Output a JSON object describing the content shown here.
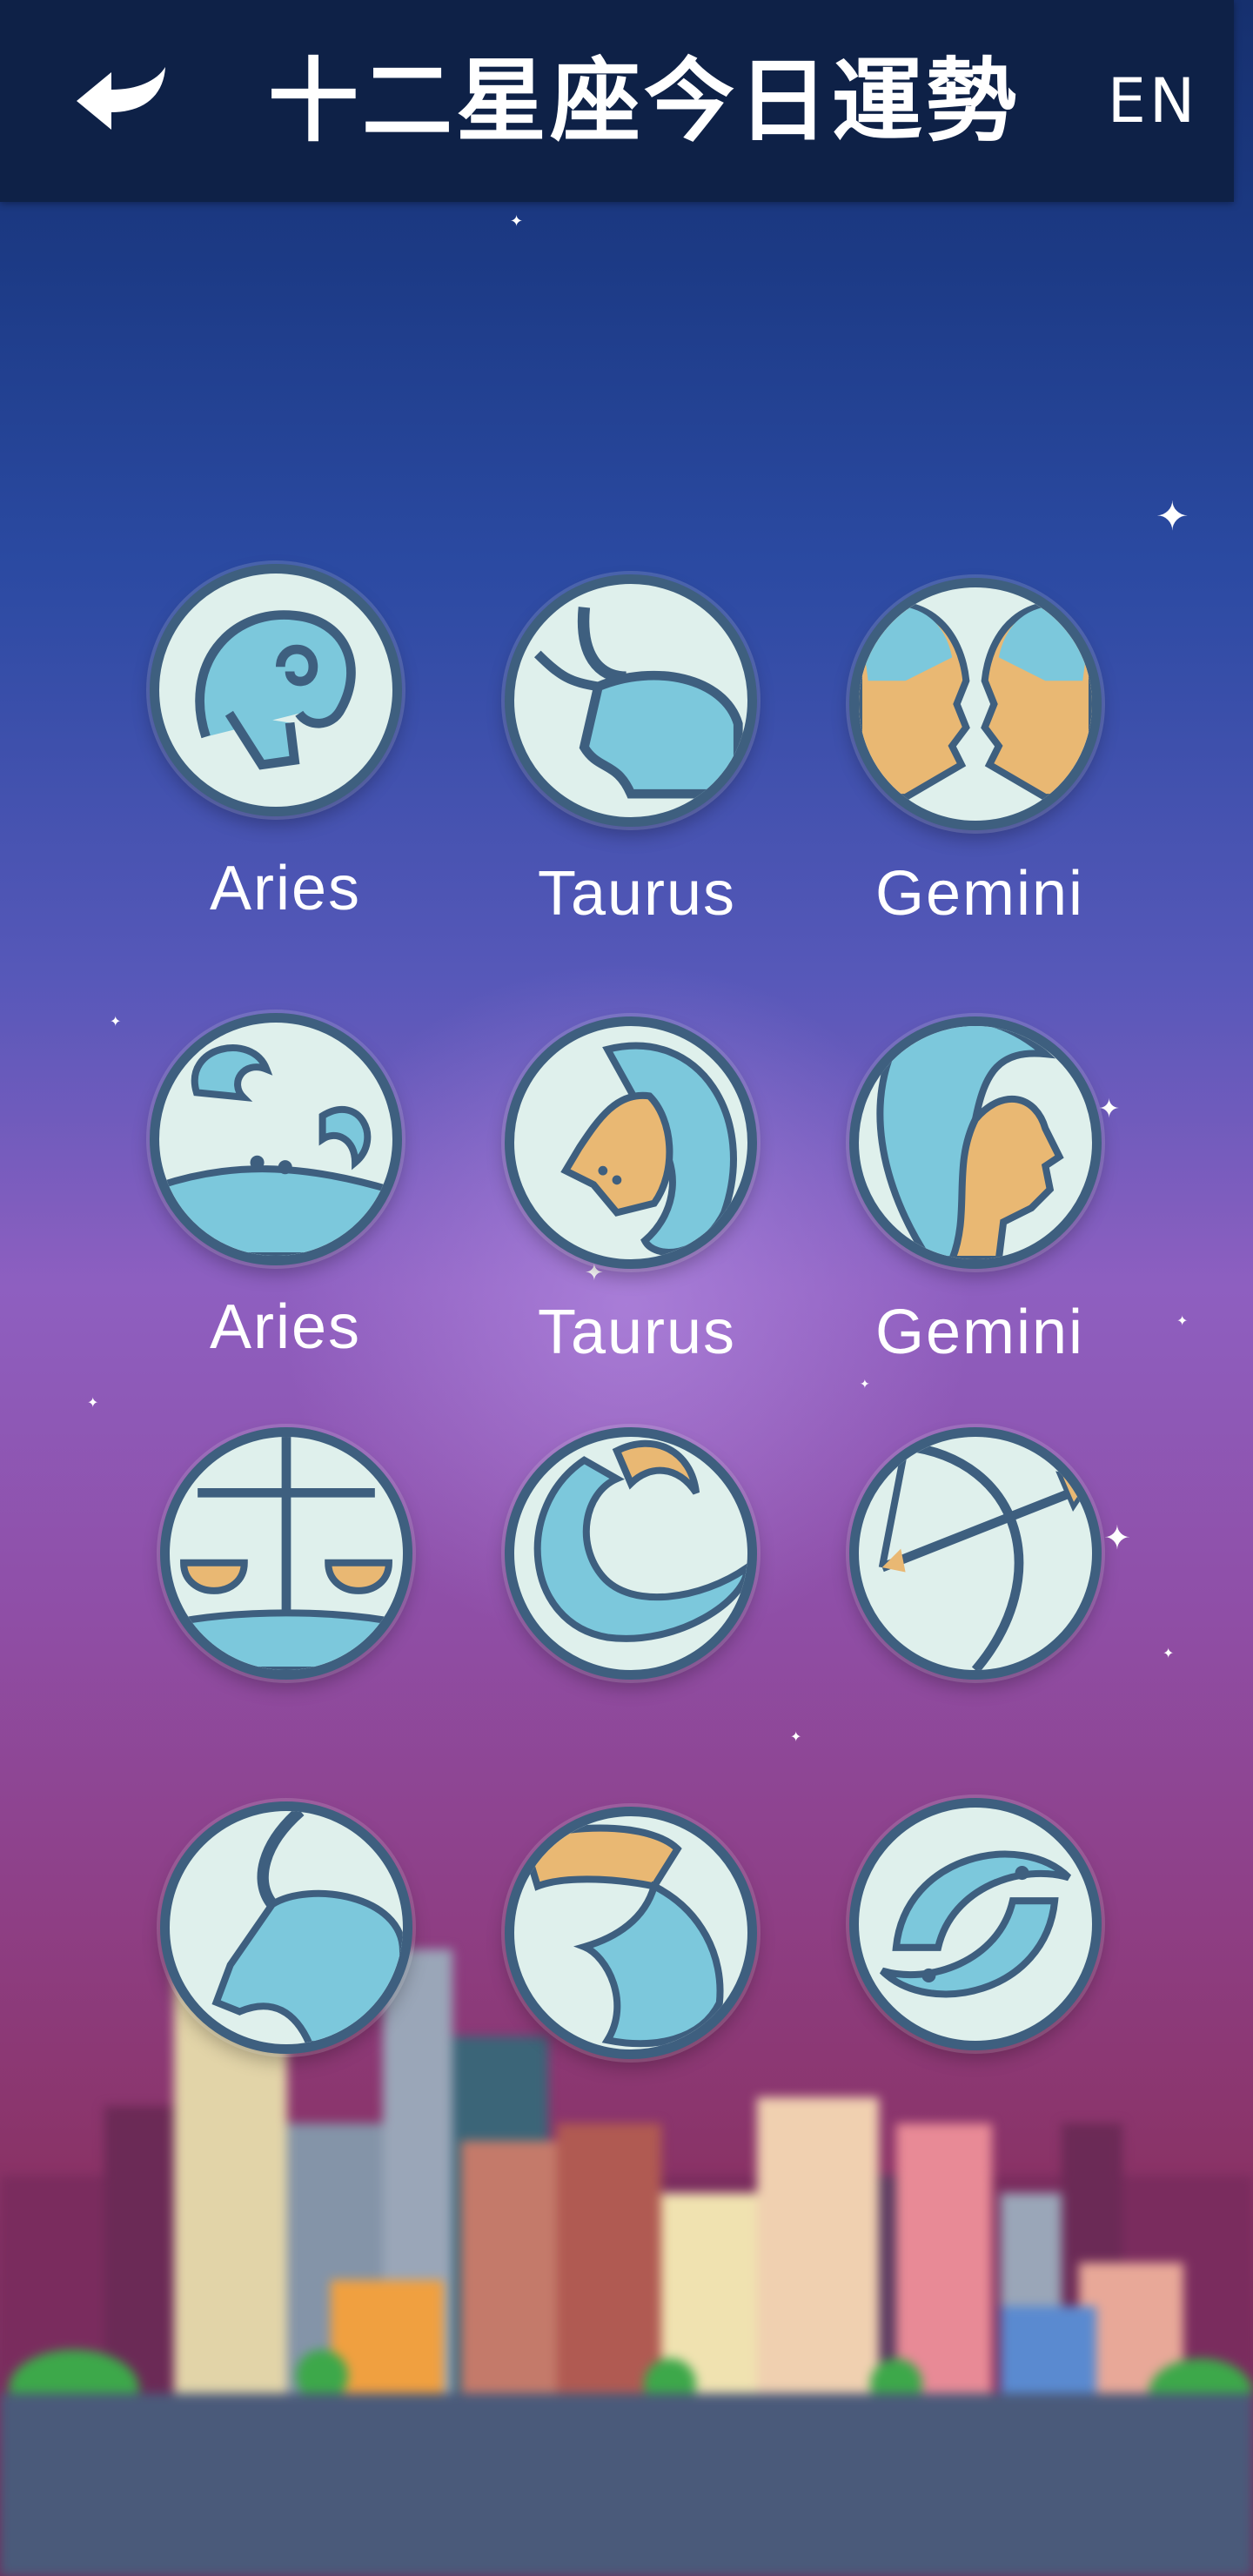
{
  "header": {
    "title": "十二星座今日運勢",
    "language_toggle": "EN",
    "back_icon": "back-arrow-icon"
  },
  "signs": [
    {
      "label": "Aries",
      "icon": "aries-ram-icon"
    },
    {
      "label": "Taurus",
      "icon": "taurus-bull-icon"
    },
    {
      "label": "Gemini",
      "icon": "gemini-twins-icon"
    },
    {
      "label": "Aries",
      "icon": "cancer-crab-icon"
    },
    {
      "label": "Taurus",
      "icon": "leo-lion-icon"
    },
    {
      "label": "Gemini",
      "icon": "virgo-maiden-icon"
    },
    {
      "label": "",
      "icon": "libra-scales-icon"
    },
    {
      "label": "",
      "icon": "scorpio-scorpion-icon"
    },
    {
      "label": "",
      "icon": "sagittarius-archer-icon"
    },
    {
      "label": "",
      "icon": "capricorn-goat-icon"
    },
    {
      "label": "",
      "icon": "aquarius-water-bearer-icon"
    },
    {
      "label": "",
      "icon": "pisces-fish-icon"
    }
  ],
  "colors": {
    "header_bg": "#0e2147",
    "icon_fill": "#dff0ec",
    "icon_outline": "#3e5f7f",
    "icon_accent_blue": "#7cc8dc",
    "icon_accent_orange": "#e9b873"
  }
}
